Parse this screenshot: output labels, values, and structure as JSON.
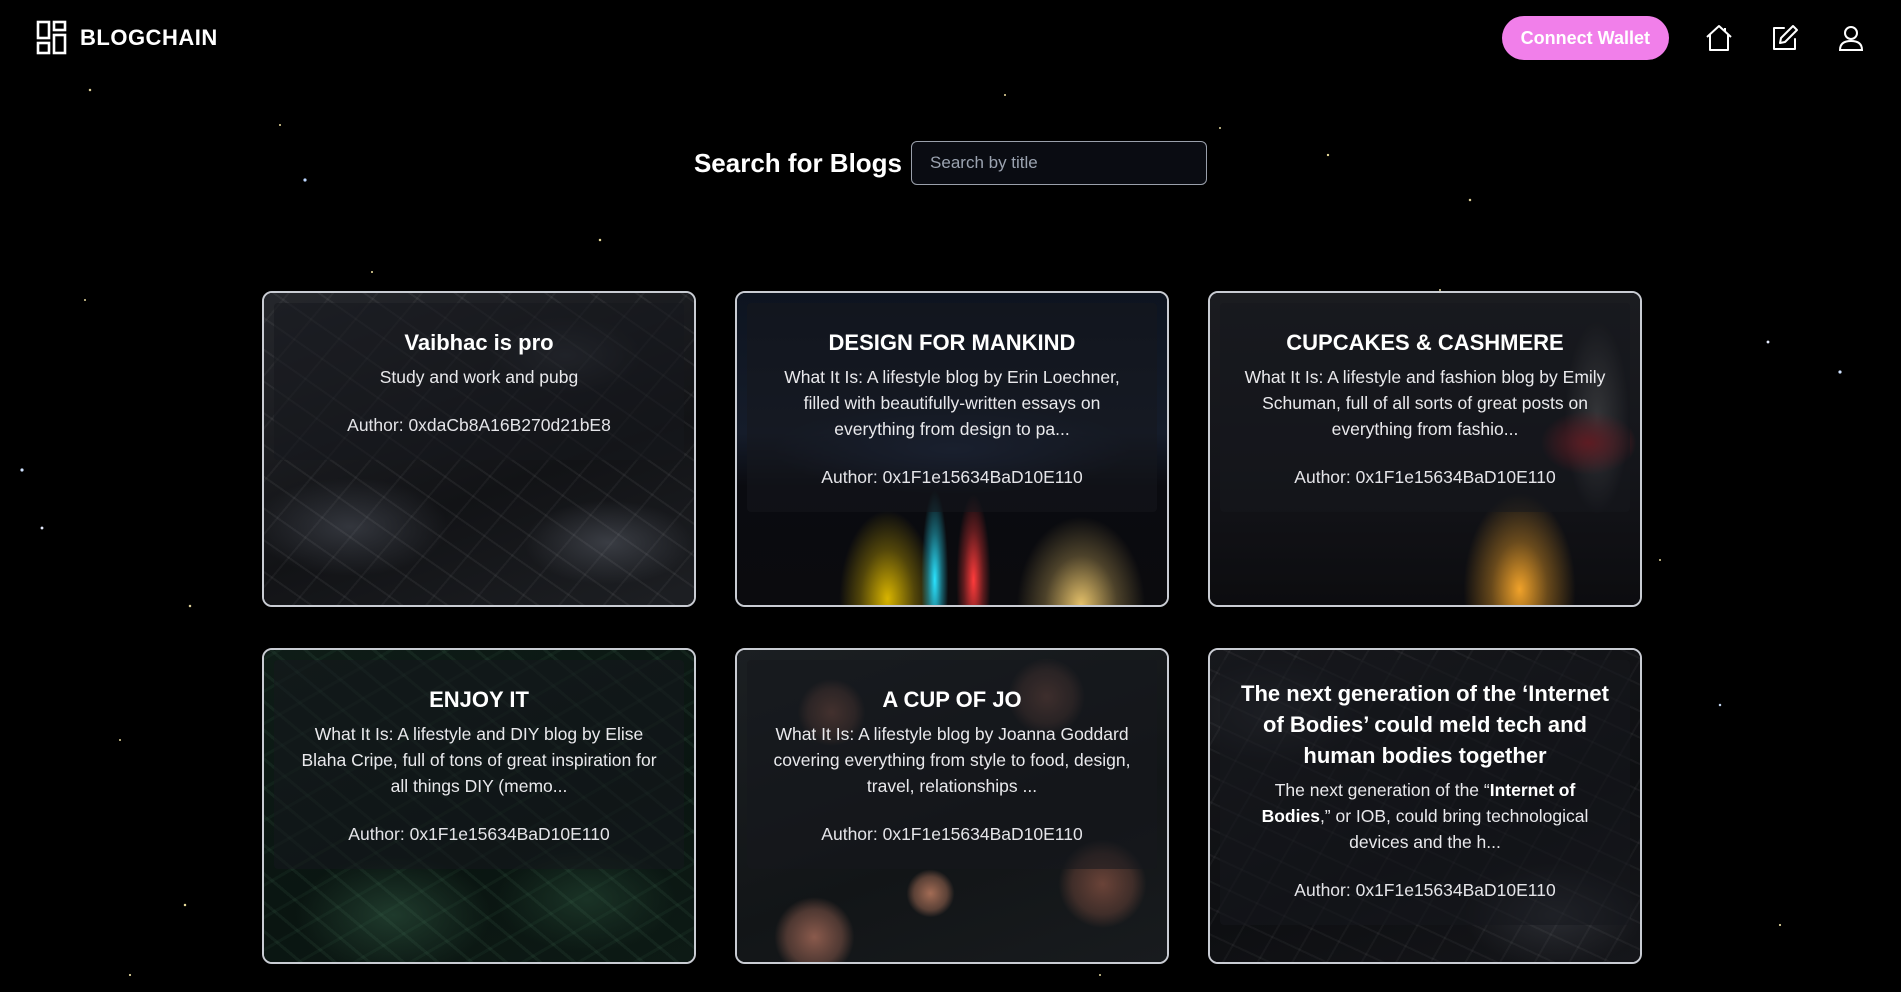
{
  "header": {
    "brand": "BLOGCHAIN",
    "connect_wallet": "Connect Wallet",
    "icons": [
      "grid-logo-icon",
      "home-icon",
      "edit-icon",
      "user-icon"
    ],
    "accent_color": "#f17fea"
  },
  "search": {
    "title": "Search for Blogs",
    "placeholder": "Search by title",
    "value": ""
  },
  "cards": [
    {
      "title": "Vaibhac is pro",
      "description": "Study and work and pubg",
      "author": "Author: 0xdaCb8A16B270d21bE8"
    },
    {
      "title": "DESIGN FOR MANKIND",
      "description": "What It Is: A lifestyle blog by Erin Loechner, filled with beautifully-written essays on everything from design to pa...",
      "author": "Author: 0x1F1e15634BaD10E110"
    },
    {
      "title": "CUPCAKES & CASHMERE",
      "description": "What It Is: A lifestyle and fashion blog by Emily Schuman, full of all sorts of great posts on everything from fashio...",
      "author": "Author: 0x1F1e15634BaD10E110"
    },
    {
      "title": "ENJOY IT",
      "description": "What It Is: A lifestyle and DIY blog by Elise Blaha Cripe, full of tons of great inspiration for all things DIY (memo...",
      "author": "Author: 0x1F1e15634BaD10E110"
    },
    {
      "title": "A CUP OF JO",
      "description": "What It Is: A lifestyle blog by Joanna Goddard covering everything from style to food, design, travel, relationships ...",
      "author": "Author: 0x1F1e15634BaD10E110"
    },
    {
      "title": "The next generation of the ‘Internet of Bodies’ could meld tech and human bodies together",
      "description_parts": [
        "The next generation of the “",
        "Internet of Bodies",
        ",” or IOB, could bring technological devices and the h..."
      ],
      "author": "Author: 0x1F1e15634BaD10E110"
    }
  ]
}
